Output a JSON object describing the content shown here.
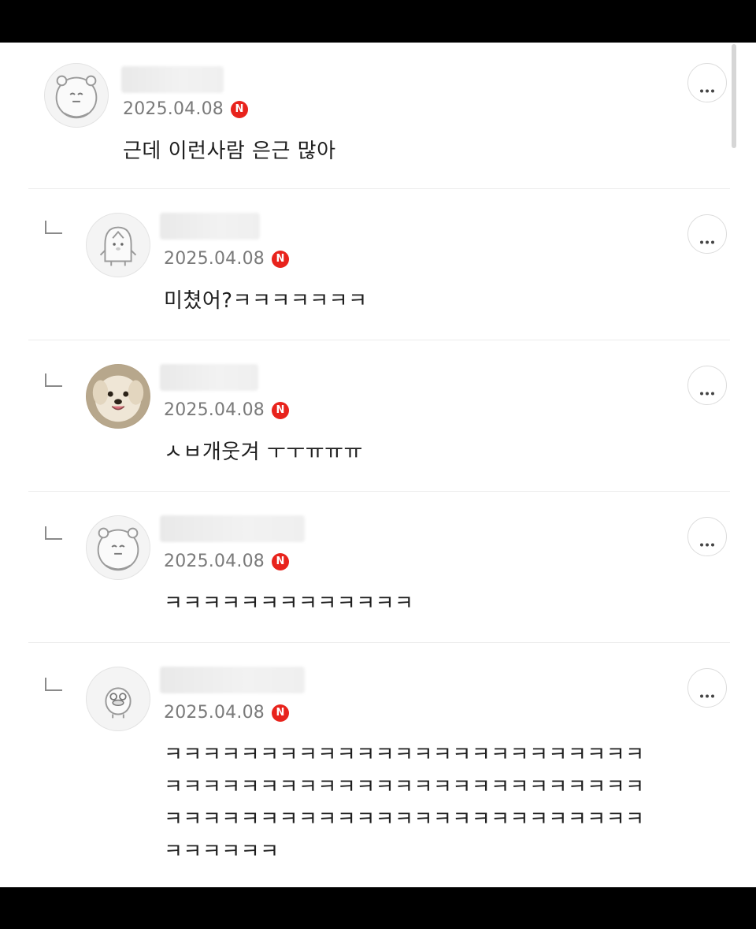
{
  "comments": [
    {
      "date": "2025.04.08",
      "badge": "N",
      "text": "근데 이런사람 은근 많아",
      "avatar": "hamster-avatar-icon",
      "is_reply": false
    },
    {
      "date": "2025.04.08",
      "badge": "N",
      "text": "미쳤어?ㅋㅋㅋㅋㅋㅋㅋ",
      "avatar": "penguin-avatar-icon",
      "is_reply": true
    },
    {
      "date": "2025.04.08",
      "badge": "N",
      "text": "ㅅㅂ개웃겨 ㅜㅜㅠㅠㅠ",
      "avatar": "dog-photo-avatar",
      "is_reply": true
    },
    {
      "date": "2025.04.08",
      "badge": "N",
      "text": "ㅋㅋㅋㅋㅋㅋㅋㅋㅋㅋㅋㅋㅋ",
      "avatar": "hamster-avatar-icon",
      "is_reply": true
    },
    {
      "date": "2025.04.08",
      "badge": "N",
      "text": "ㅋㅋㅋㅋㅋㅋㅋㅋㅋㅋㅋㅋㅋㅋㅋㅋㅋㅋㅋㅋㅋㅋㅋㅋㅋ\nㅋㅋㅋㅋㅋㅋㅋㅋㅋㅋㅋㅋㅋㅋㅋㅋㅋㅋㅋㅋㅋㅋㅋㅋㅋ\nㅋㅋㅋㅋㅋㅋㅋㅋㅋㅋㅋㅋㅋㅋㅋㅋㅋㅋㅋㅋㅋㅋㅋㅋㅋ\nㅋㅋㅋㅋㅋㅋ",
      "avatar": "duck-avatar-icon",
      "is_reply": true
    }
  ],
  "colors": {
    "badge": "#e8231c",
    "date": "#7a7a7a",
    "text": "#1e1e1e"
  },
  "more_button_icon": "more-horizontal-icon"
}
